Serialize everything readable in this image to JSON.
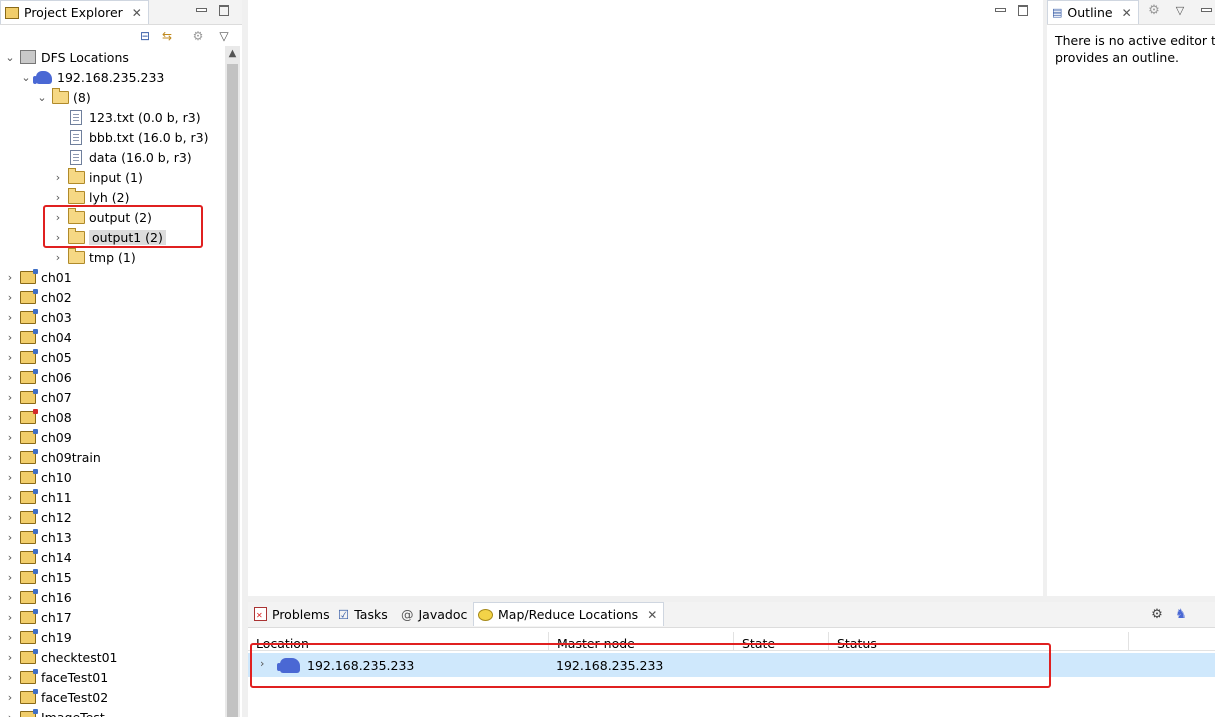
{
  "project_explorer": {
    "tab_label": "Project Explorer",
    "tree": [
      {
        "label": "DFS Locations",
        "level": 0,
        "expanded": true,
        "icon": "dfs-icon"
      },
      {
        "label": "192.168.235.233",
        "level": 1,
        "expanded": true,
        "icon": "elephant-icon"
      },
      {
        "label": "(8)",
        "level": 2,
        "expanded": true,
        "icon": "folder-icon"
      },
      {
        "label": "123.txt (0.0 b, r3)",
        "level": 3,
        "icon": "file-icon"
      },
      {
        "label": "bbb.txt (16.0 b, r3)",
        "level": 3,
        "icon": "file-icon"
      },
      {
        "label": "data (16.0 b, r3)",
        "level": 3,
        "icon": "file-icon"
      },
      {
        "label": "input (1)",
        "level": 3,
        "collapsed": true,
        "icon": "folder-icon"
      },
      {
        "label": "lyh (2)",
        "level": 3,
        "collapsed": true,
        "icon": "folder-icon"
      },
      {
        "label": "output (2)",
        "level": 3,
        "collapsed": true,
        "icon": "folder-icon"
      },
      {
        "label": "output1 (2)",
        "level": 3,
        "collapsed": true,
        "icon": "folder-icon",
        "selected": true
      },
      {
        "label": "tmp (1)",
        "level": 3,
        "collapsed": true,
        "icon": "folder-icon"
      }
    ],
    "projects": [
      "ch01",
      "ch02",
      "ch03",
      "ch04",
      "ch05",
      "ch06",
      "ch07",
      "ch08",
      "ch09",
      "ch09train",
      "ch10",
      "ch11",
      "ch12",
      "ch13",
      "ch14",
      "ch15",
      "ch16",
      "ch17",
      "ch19",
      "checktest01",
      "faceTest01",
      "faceTest02",
      "ImageTest"
    ],
    "error_project": "ch08"
  },
  "outline": {
    "tab_label": "Outline",
    "message_line1": "There is no active editor tha",
    "message_line2": "provides an outline."
  },
  "bottom_panel": {
    "tabs": [
      "Problems",
      "Tasks",
      "Javadoc",
      "Map/Reduce Locations"
    ],
    "active_tab": "Map/Reduce Locations",
    "columns": [
      "Location",
      "Master node",
      "State",
      "Status"
    ],
    "rows": [
      {
        "location": "192.168.235.233",
        "master_node": "192.168.235.233",
        "state": "",
        "status": ""
      }
    ]
  },
  "colors": {
    "highlight_box": "#e02020",
    "selected_row": "#cfe8fc",
    "accent": "#3a5fa8"
  }
}
